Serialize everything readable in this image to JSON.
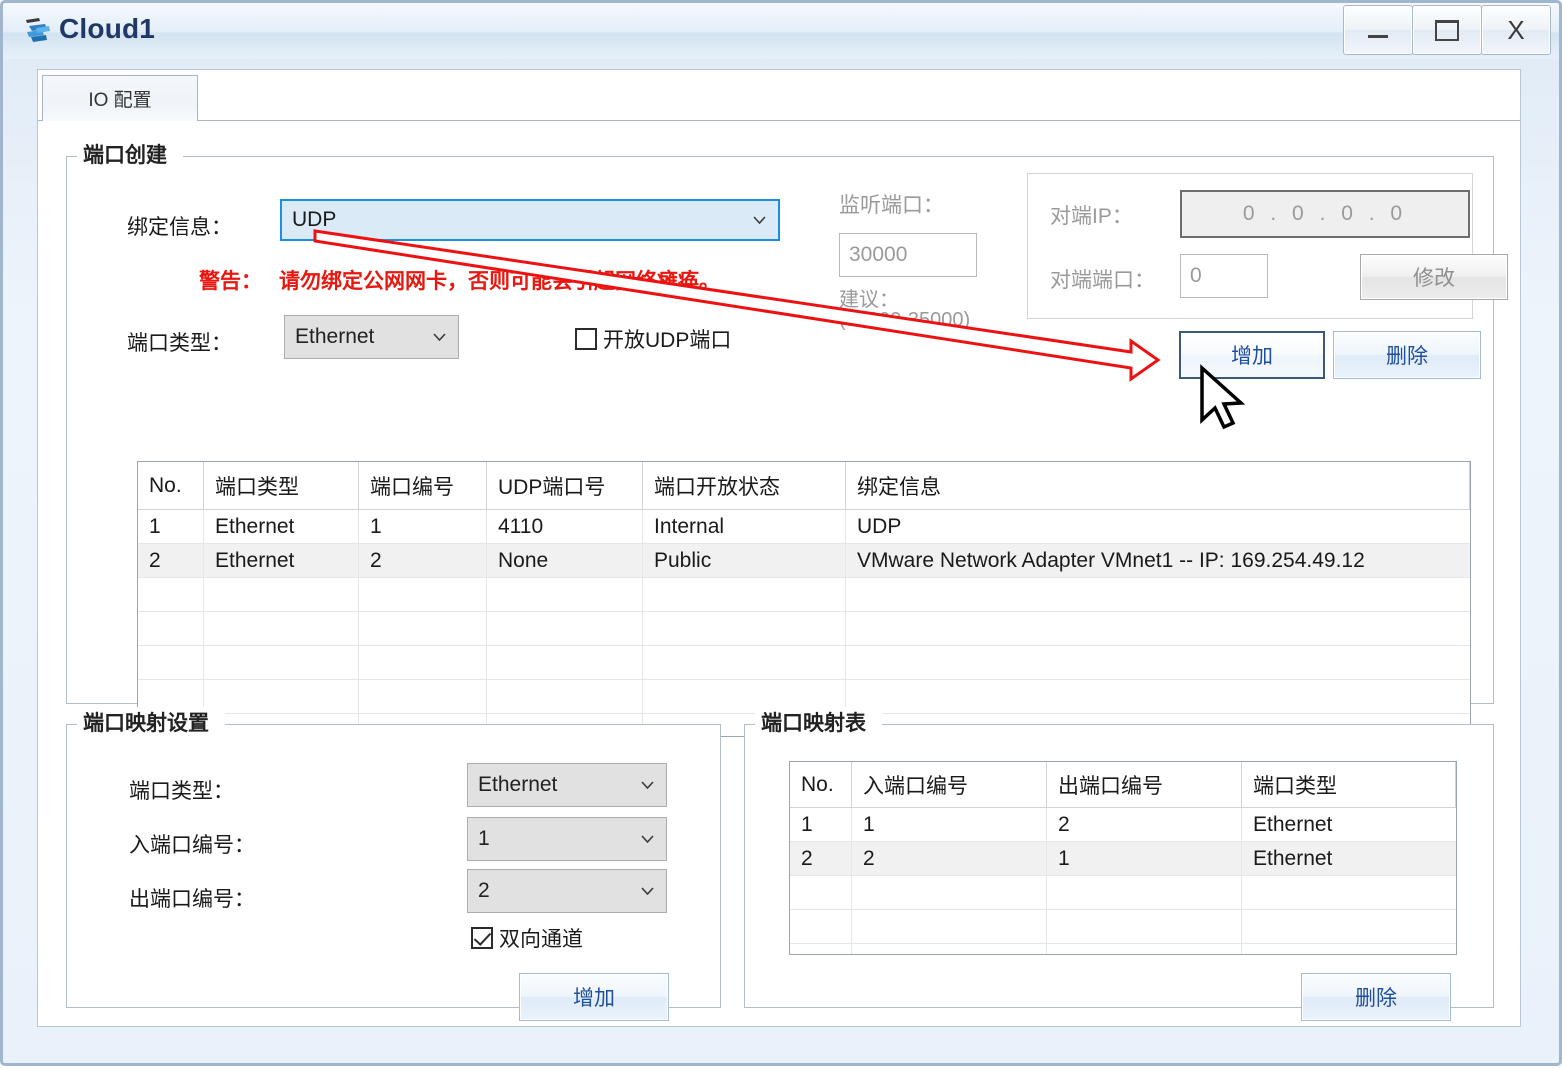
{
  "window": {
    "title": "Cloud1",
    "icon": "cloud-icon",
    "controls": [
      {
        "name": "minimize-button",
        "glyph": "—"
      },
      {
        "name": "maximize-button",
        "glyph": "❐"
      },
      {
        "name": "close-button",
        "glyph": "X"
      }
    ]
  },
  "tabs": [
    {
      "label": "IO 配置",
      "active": true
    }
  ],
  "port_creation": {
    "group_title": "端口创建",
    "binding_label": "绑定信息：",
    "binding_value": "UDP",
    "warning_label": "警告：",
    "warning_text": "请勿绑定公网网卡，否则可能会引起网络瘫痪。",
    "port_type_label": "端口类型：",
    "port_type_value": "Ethernet",
    "open_udp_label": "开放UDP端口",
    "open_udp_checked": false,
    "listen_port_label": "监听端口：",
    "listen_port_value": "30000",
    "suggest_label": "建议：",
    "suggest_range": "(30000-35000)",
    "peer_ip_label": "对端IP：",
    "peer_ip_value": "0 . 0 . 0 . 0",
    "peer_port_label": "对端端口：",
    "peer_port_value": "0",
    "modify_button": "修改",
    "add_button": "增加",
    "delete_button": "删除"
  },
  "port_table": {
    "headers": [
      "No.",
      "端口类型",
      "端口编号",
      "UDP端口号",
      "端口开放状态",
      "绑定信息"
    ],
    "rows": [
      {
        "no": "1",
        "type": "Ethernet",
        "number": "1",
        "udp_port": "4110",
        "state": "Internal",
        "binding": "UDP",
        "selected": false
      },
      {
        "no": "2",
        "type": "Ethernet",
        "number": "2",
        "udp_port": "None",
        "state": "Public",
        "binding": "VMware Network Adapter VMnet1 -- IP: 169.254.49.12",
        "selected": true
      }
    ],
    "empty_rows": 5
  },
  "mapping_settings": {
    "group_title": "端口映射设置",
    "port_type_label": "端口类型：",
    "port_type_value": "Ethernet",
    "in_port_label": "入端口编号：",
    "in_port_value": "1",
    "out_port_label": "出端口编号：",
    "out_port_value": "2",
    "bidirectional_label": "双向通道",
    "bidirectional_checked": true,
    "add_button": "增加"
  },
  "mapping_table": {
    "group_title": "端口映射表",
    "headers": [
      "No.",
      "入端口编号",
      "出端口编号",
      "端口类型"
    ],
    "rows": [
      {
        "no": "1",
        "in_port": "1",
        "out_port": "2",
        "type": "Ethernet",
        "selected": false
      },
      {
        "no": "2",
        "in_port": "2",
        "out_port": "1",
        "type": "Ethernet",
        "selected": true
      }
    ],
    "empty_rows": 3,
    "delete_button": "删除"
  },
  "annotation": {
    "arrow_color": "#ee1111",
    "from": "binding-info-combobox",
    "to": "add-port-button"
  },
  "colors": {
    "accent_blue": "#1a8fe3",
    "warning_red": "#e8170f",
    "title_text": "#1f3864",
    "button_text": "#1f4e9c"
  }
}
